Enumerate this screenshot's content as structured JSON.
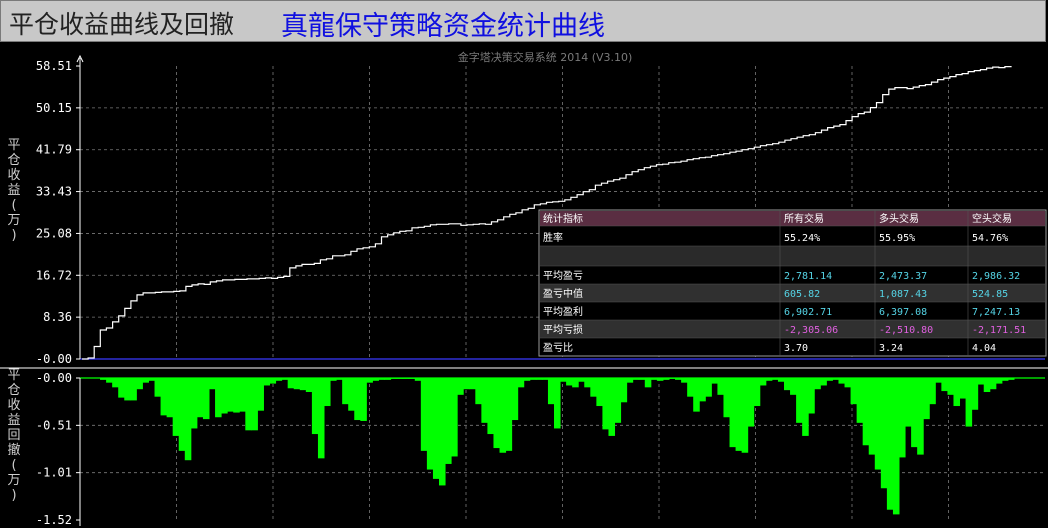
{
  "header": {
    "title": "平仓收益曲线及回撤",
    "subtitle": "真龍保守策略资金统计曲线"
  },
  "colors": {
    "background": "#000000",
    "equity_line": "#ffffff",
    "zero_line": "#3a3aff",
    "drawdown_fill": "#00ff00",
    "drawdown_baseline": "#00ff00",
    "grid": "#7a7a7a",
    "table_header": "#5a2e42",
    "value_cyan": "#55d4e6",
    "value_magenta": "#e060e0",
    "value_white": "#ffffff"
  },
  "chart_data": [
    {
      "type": "line",
      "title": "金字塔决策交易系统 2014 (V3.10)",
      "ylabel": "平仓收益(万)",
      "y_ticks": [
        "58.51",
        "50.15",
        "41.79",
        "33.43",
        "25.08",
        "16.72",
        "8.36",
        "-0.00"
      ],
      "ylim": [
        0,
        58.51
      ],
      "grid": true,
      "series": [
        {
          "values": [
            0,
            0.2,
            2.5,
            5.8,
            6.2,
            7.4,
            8.6,
            10.1,
            11.6,
            12.8,
            13.2,
            13.2,
            13.3,
            13.4,
            13.4,
            13.5,
            13.6,
            14.5,
            14.8,
            15.0,
            14.9,
            15.4,
            15.6,
            15.8,
            15.8,
            15.9,
            15.9,
            16.0,
            16.0,
            16.1,
            16.2,
            16.1,
            16.3,
            16.5,
            18.2,
            18.6,
            18.9,
            18.9,
            19.1,
            19.8,
            20.0,
            20.6,
            20.6,
            20.8,
            21.5,
            22.0,
            22.2,
            22.4,
            23.0,
            24.4,
            24.8,
            25.2,
            25.5,
            25.6,
            26.2,
            26.3,
            26.5,
            26.8,
            26.9,
            26.9,
            27.0,
            27.0,
            26.7,
            26.8,
            26.9,
            27.0,
            26.9,
            27.4,
            27.8,
            28.4,
            28.9,
            29.2,
            29.8,
            30.1,
            30.8,
            31.0,
            31.3,
            31.4,
            31.5,
            31.8,
            32.3,
            32.8,
            33.4,
            33.8,
            34.7,
            35.1,
            35.5,
            35.8,
            36.1,
            36.8,
            37.4,
            37.8,
            38.2,
            38.5,
            38.8,
            38.9,
            39.2,
            39.3,
            39.5,
            39.8,
            40.0,
            40.2,
            40.3,
            40.6,
            40.8,
            41.0,
            41.3,
            41.5,
            41.8,
            42.0,
            42.3,
            42.6,
            42.8,
            43.0,
            43.3,
            43.7,
            44.0,
            44.3,
            44.6,
            44.8,
            45.2,
            45.7,
            46.2,
            46.5,
            46.8,
            47.6,
            48.4,
            49.0,
            49.3,
            50.2,
            51.2,
            52.8,
            53.9,
            54.2,
            54.2,
            54.0,
            54.3,
            54.6,
            54.8,
            55.3,
            55.8,
            56.1,
            56.4,
            56.8,
            57.0,
            57.4,
            57.6,
            57.8,
            58.1,
            58.3,
            58.2,
            58.4,
            58.51
          ]
        }
      ]
    },
    {
      "type": "area",
      "ylabel": "平仓收益回撤(万)",
      "y_ticks": [
        "-0.00",
        "-0.51",
        "-1.01",
        "-1.52"
      ],
      "ylim": [
        -1.52,
        0
      ],
      "grid": true,
      "series": [
        {
          "values": [
            0,
            -0.02,
            -0.05,
            -0.1,
            -0.21,
            -0.24,
            -0.24,
            -0.12,
            -0.05,
            -0.03,
            -0.2,
            -0.4,
            -0.42,
            -0.62,
            -0.78,
            -0.88,
            -0.54,
            -0.42,
            -0.44,
            -0.12,
            -0.42,
            -0.38,
            -0.36,
            -0.37,
            -0.36,
            -0.56,
            -0.56,
            -0.35,
            -0.08,
            -0.06,
            -0.03,
            -0.02,
            -0.11,
            -0.12,
            -0.13,
            -0.15,
            -0.6,
            -0.86,
            -0.3,
            -0.03,
            -0.02,
            -0.28,
            -0.35,
            -0.45,
            -0.46,
            -0.05,
            -0.03,
            -0.02,
            -0.02,
            -0.01,
            -0.01,
            -0.01,
            -0.01,
            -0.03,
            -0.78,
            -0.98,
            -1.08,
            -1.15,
            -0.92,
            -0.84,
            -0.18,
            -0.12,
            -0.12,
            -0.28,
            -0.48,
            -0.6,
            -0.75,
            -0.8,
            -0.78,
            -0.45,
            -0.1,
            -0.03,
            -0.02,
            -0.02,
            -0.02,
            -0.28,
            -0.54,
            -0.04,
            -0.08,
            -0.1,
            -0.04,
            -0.1,
            -0.2,
            -0.3,
            -0.55,
            -0.62,
            -0.48,
            -0.26,
            -0.05,
            -0.02,
            -0.02,
            -0.1,
            -0.02,
            -0.03,
            -0.02,
            -0.01,
            -0.02,
            -0.05,
            -0.2,
            -0.36,
            -0.25,
            -0.2,
            -0.06,
            -0.18,
            -0.42,
            -0.74,
            -0.78,
            -0.8,
            -0.52,
            -0.3,
            -0.08,
            -0.03,
            -0.02,
            -0.04,
            -0.13,
            -0.18,
            -0.48,
            -0.62,
            -0.38,
            -0.12,
            -0.08,
            -0.03,
            -0.02,
            -0.06,
            -0.1,
            -0.28,
            -0.48,
            -0.72,
            -0.82,
            -0.98,
            -1.18,
            -1.41,
            -1.46,
            -0.85,
            -0.52,
            -0.74,
            -0.82,
            -0.44,
            -0.28,
            -0.05,
            -0.14,
            -0.18,
            -0.3,
            -0.22,
            -0.52,
            -0.34,
            -0.07,
            -0.15,
            -0.12,
            -0.06,
            -0.03,
            -0.02
          ]
        }
      ]
    }
  ],
  "stats": {
    "headers": [
      "统计指标",
      "所有交易",
      "多头交易",
      "空头交易"
    ],
    "rows": [
      {
        "label": "胜率",
        "all": "55.24%",
        "long": "55.95%",
        "short": "54.76%",
        "color": "white"
      },
      {
        "label": "",
        "all": "",
        "long": "",
        "short": "",
        "color": "white"
      },
      {
        "label": "平均盈亏",
        "all": "2,781.14",
        "long": "2,473.37",
        "short": "2,986.32",
        "color": "cyan"
      },
      {
        "label": "盈亏中值",
        "all": "605.82",
        "long": "1,087.43",
        "short": "524.85",
        "color": "cyan"
      },
      {
        "label": "平均盈利",
        "all": "6,902.71",
        "long": "6,397.08",
        "short": "7,247.13",
        "color": "cyan"
      },
      {
        "label": "平均亏损",
        "all": "-2,305.06",
        "long": "-2,510.80",
        "short": "-2,171.51",
        "color": "magenta"
      },
      {
        "label": "盈亏比",
        "all": "3.70",
        "long": "3.24",
        "short": "4.04",
        "color": "white"
      }
    ]
  }
}
